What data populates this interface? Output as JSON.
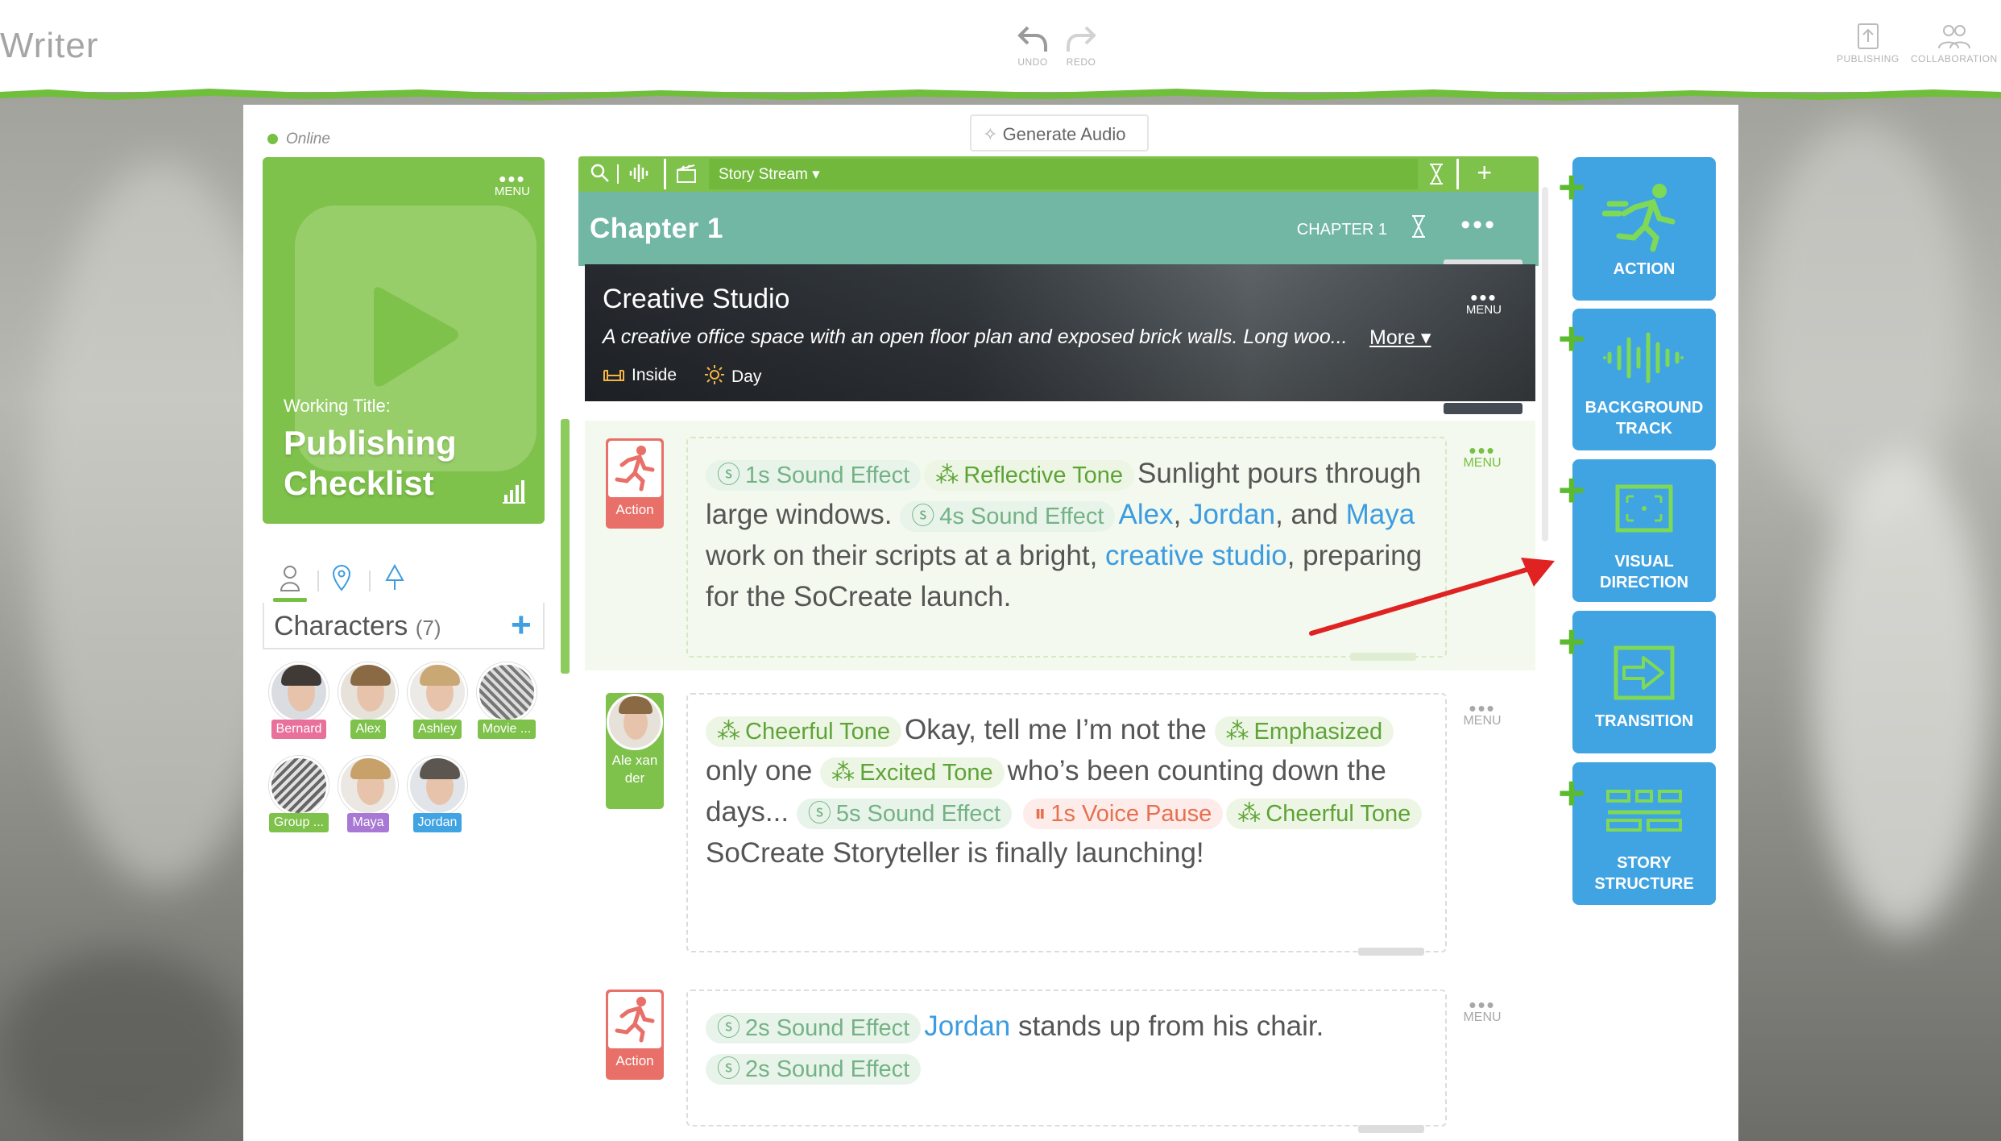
{
  "header": {
    "app_title": "Writer",
    "undo_label": "UNDO",
    "redo_label": "REDO",
    "publishing_label": "PUBLISHING",
    "collaboration_label": "COLLABORATION"
  },
  "status": {
    "online_label": "Online"
  },
  "story": {
    "menu_label": "MENU",
    "working_title_label": "Working Title:",
    "title": "Publishing Checklist"
  },
  "characters": {
    "title": "Characters",
    "count": "(7)",
    "items": [
      {
        "name": "Bernard",
        "color": "#e8709a"
      },
      {
        "name": "Alex",
        "color": "#7ec14b"
      },
      {
        "name": "Ashley",
        "color": "#7ec14b"
      },
      {
        "name": "Movie ...",
        "color": "#7ec14b"
      },
      {
        "name": "Group ...",
        "color": "#7ec14b"
      },
      {
        "name": "Maya",
        "color": "#a878d4"
      },
      {
        "name": "Jordan",
        "color": "#40a3e2"
      }
    ]
  },
  "toolbar": {
    "generate_audio": "Generate Audio",
    "stream_select": "Story Stream ▾",
    "add": "+"
  },
  "chapter": {
    "title": "Chapter 1",
    "label": "CHAPTER 1"
  },
  "location": {
    "title": "Creative Studio",
    "description": "A creative office space with an open floor plan and exposed brick walls. Long woo...",
    "more": "More ▾",
    "menu_label": "MENU",
    "place": "Inside",
    "time": "Day"
  },
  "blocks": [
    {
      "badge": "Action",
      "menu": "MENU",
      "tags": {
        "t1": "1s Sound Effect",
        "t2": "Reflective Tone",
        "t3": "4s Sound Effect"
      },
      "text": {
        "a": "Sunlight pours through large windows.",
        "alex": "Alex",
        "comma1": ",",
        "jordan": "Jordan",
        "b": ", and",
        "maya": "Maya",
        "c": "work on their scripts at a bright,",
        "studio": "creative studio",
        "d": ", preparing for the SoCreate launch."
      }
    },
    {
      "badge": "Ale xan der",
      "menu": "MENU",
      "tags": {
        "t1": "Cheerful Tone",
        "t2": "Emphasized",
        "t3": "Excited Tone",
        "t4": "5s Sound Effect",
        "t5": "1s Voice Pause",
        "t6": "Cheerful Tone"
      },
      "text": {
        "a": "Okay, tell me I’m not the",
        "b": "only one",
        "c": "who’s been counting down the days...",
        "d": "SoCreate Storyteller is finally launching!"
      }
    },
    {
      "badge": "Action",
      "menu": "MENU",
      "tags": {
        "t1": "2s Sound Effect",
        "t2": "2s Sound Effect"
      },
      "text": {
        "jordan": "Jordan",
        "a": "stands up from his chair."
      }
    }
  ],
  "tools": [
    {
      "label": "ACTION"
    },
    {
      "label": "BACKGROUND TRACK"
    },
    {
      "label": "VISUAL DIRECTION"
    },
    {
      "label": "TRANSITION"
    },
    {
      "label": "STORY STRUCTURE"
    }
  ],
  "colors": {
    "accent_green": "#77c043",
    "tool_blue": "#40a3e2",
    "chapter_teal": "#72b7a4",
    "link_blue": "#3d9ce0"
  }
}
